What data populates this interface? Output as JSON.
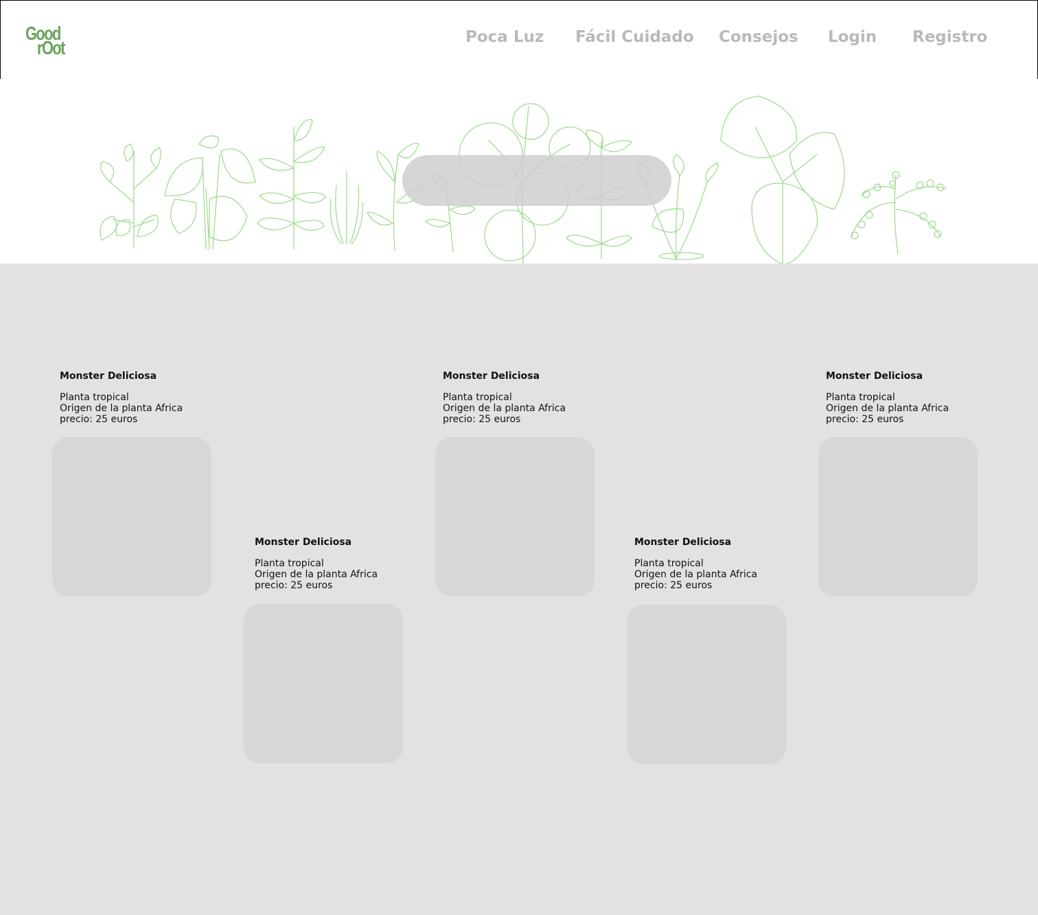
{
  "header": {
    "logo": {
      "line1": "Good",
      "line2": "rOot"
    },
    "nav": [
      {
        "label": "Poca Luz"
      },
      {
        "label": "Fácil Cuidado"
      },
      {
        "label": "Consejos"
      },
      {
        "label": "Login"
      },
      {
        "label": "Registro"
      }
    ]
  },
  "hero": {
    "illustration": "line-drawn-plants",
    "search": {
      "placeholder": ""
    }
  },
  "colors": {
    "brand": "#6aa35a",
    "nav_text": "#b9b9b9",
    "plant_lines": "#9fdc8f",
    "content_bg": "#e2e2e2",
    "card_image": "#d7d7d7"
  },
  "products": [
    {
      "name": "Monster Deliciosa",
      "type": "Planta tropical",
      "origin": "Origen de la planta Africa",
      "price": "precio: 25 euros"
    },
    {
      "name": "Monster Deliciosa",
      "type": "Planta tropical",
      "origin": "Origen de la planta Africa",
      "price": "precio: 25 euros"
    },
    {
      "name": "Monster Deliciosa",
      "type": "Planta tropical",
      "origin": "Origen de la planta Africa",
      "price": "precio: 25 euros"
    },
    {
      "name": "Monster Deliciosa",
      "type": "Planta tropical",
      "origin": "Origen de la planta Africa",
      "price": "precio: 25 euros"
    },
    {
      "name": "Monster Deliciosa",
      "type": "Planta tropical",
      "origin": "Origen de la planta Africa",
      "price": "precio: 25 euros"
    }
  ]
}
